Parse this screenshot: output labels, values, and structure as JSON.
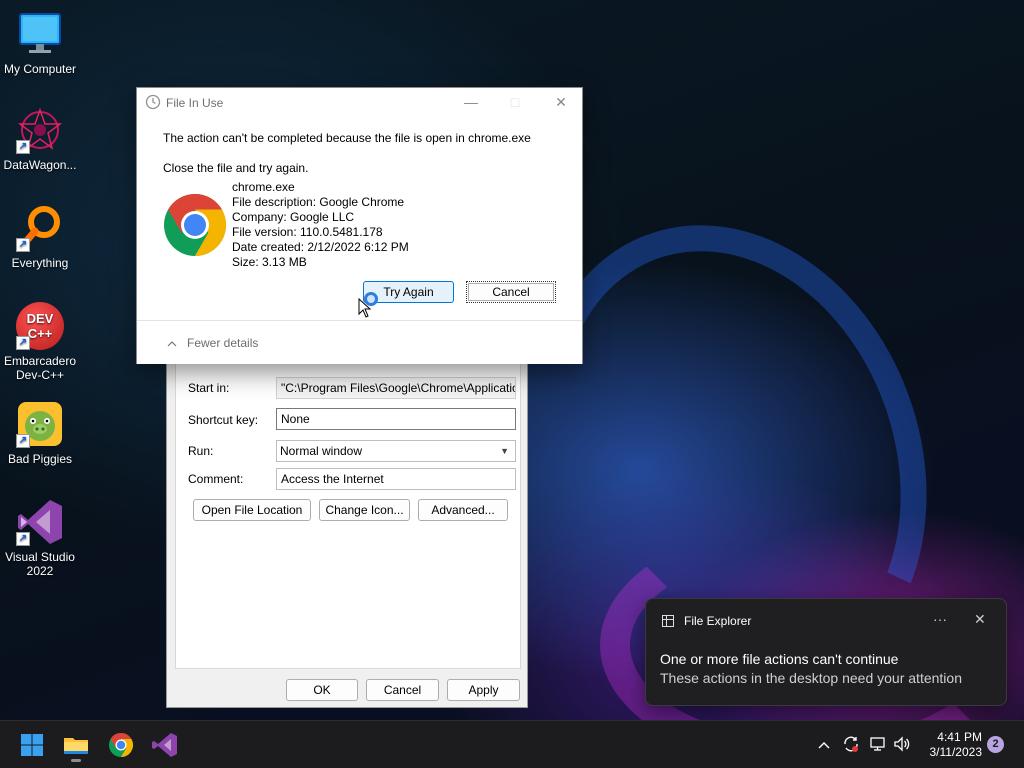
{
  "desktop": {
    "icons": [
      {
        "label": "My Computer",
        "icon": "monitor-icon"
      },
      {
        "label": "DataWagon...",
        "icon": "datawagon-icon"
      },
      {
        "label": "Everything",
        "icon": "magnifier-icon"
      },
      {
        "label": "Embarcadero Dev-C++",
        "icon": "devcpp-icon",
        "glyph_text": "DEV C++"
      },
      {
        "label": "Bad Piggies",
        "icon": "bad-piggies-icon"
      },
      {
        "label": "Visual Studio 2022",
        "icon": "visual-studio-icon"
      }
    ]
  },
  "properties_window": {
    "fields": [
      {
        "label": "Start in:",
        "value": "\"C:\\Program Files\\Google\\Chrome\\Application\""
      },
      {
        "label": "Shortcut key:",
        "value": "None"
      },
      {
        "label": "Run:",
        "value": "Normal window"
      },
      {
        "label": "Comment:",
        "value": "Access the Internet"
      }
    ],
    "buttons": {
      "open_location": "Open File Location",
      "change_icon": "Change Icon...",
      "advanced": "Advanced..."
    },
    "footer": {
      "ok": "OK",
      "cancel": "Cancel",
      "apply": "Apply"
    }
  },
  "dialog": {
    "title": "File In Use",
    "message": "The action can't be completed because the file is open in chrome.exe",
    "instruction": "Close the file and try again.",
    "file_info": [
      "chrome.exe",
      "File description: Google Chrome",
      "Company: Google LLC",
      "File version: 110.0.5481.178",
      "Date created: 2/12/2022 6:12 PM",
      "Size: 3.13 MB"
    ],
    "try_again": "Try Again",
    "cancel": "Cancel",
    "fewer_details": "Fewer details"
  },
  "toast": {
    "app": "File Explorer",
    "more": "···",
    "heading": "One or more file actions can't continue",
    "body": "These actions in the desktop need your attention"
  },
  "taskbar": {
    "time": "4:41 PM",
    "date": "3/11/2023",
    "notification_count": "2"
  },
  "colors": {
    "accent": "#0067c0",
    "chrome_red": "#db4437",
    "chrome_yellow": "#f4b400",
    "chrome_green": "#0f9d58",
    "chrome_blue": "#4285f4"
  }
}
